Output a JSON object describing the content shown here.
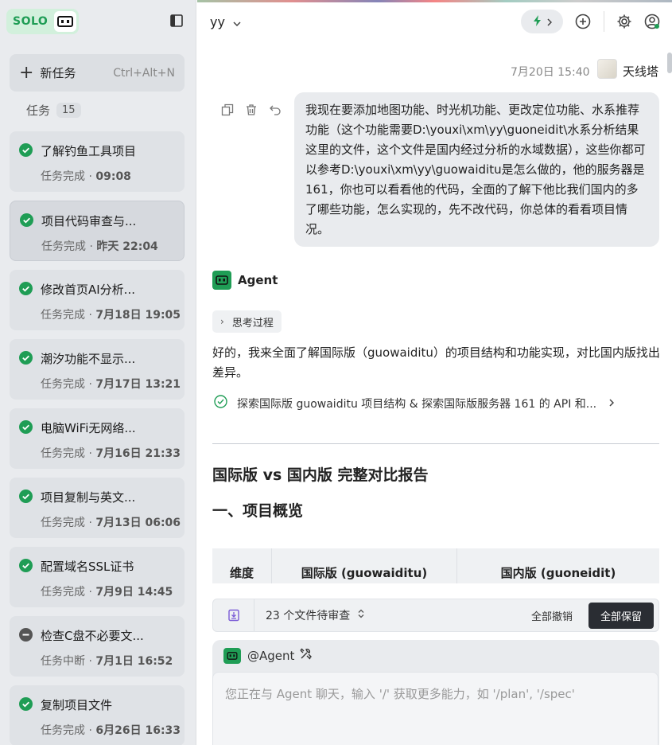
{
  "sidebar": {
    "solo_label": "SOLO",
    "new_task": {
      "label": "新任务",
      "shortcut": "Ctrl+Alt+N"
    },
    "tasks_label": "任务",
    "tasks_count": "15",
    "tasks": [
      {
        "title": "了解钓鱼工具项目",
        "status_text": "任务完成",
        "time": "09:08",
        "state": "done"
      },
      {
        "title": "项目代码审查与...",
        "status_text": "任务完成",
        "time": "昨天 22:04",
        "state": "done"
      },
      {
        "title": "修改首页AI分析...",
        "status_text": "任务完成",
        "time": "7月18日 19:05",
        "state": "done"
      },
      {
        "title": "潮汐功能不显示...",
        "status_text": "任务完成",
        "time": "7月17日 13:21",
        "state": "done"
      },
      {
        "title": "电脑WiFi无网络...",
        "status_text": "任务完成",
        "time": "7月16日 21:33",
        "state": "done"
      },
      {
        "title": "项目复制与英文...",
        "status_text": "任务完成",
        "time": "7月13日 06:06",
        "state": "done"
      },
      {
        "title": "配置域名SSL证书",
        "status_text": "任务完成",
        "time": "7月9日 14:45",
        "state": "done"
      },
      {
        "title": "检查C盘不必要文...",
        "status_text": "任务中断",
        "time": "7月1日 16:52",
        "state": "interrupted"
      },
      {
        "title": "复制项目文件",
        "status_text": "任务完成",
        "time": "6月26日 16:33",
        "state": "done"
      }
    ]
  },
  "header": {
    "project": "yy"
  },
  "chat": {
    "timestamp": "7月20日 15:40",
    "user_name": "天线塔",
    "user_message": "我现在要添加地图功能、时光机功能、更改定位功能、水系推荐功能（这个功能需要D:\\youxi\\xm\\yy\\guoneidit\\水系分析结果这里的文件，这个文件是国内经过分析的水域数据），这些你都可以参考D:\\youxi\\xm\\yy\\guowaiditu是怎么做的，他的服务器是161，你也可以看看他的代码，全面的了解下他比我们国内的多了哪些功能，怎么实现的，先不改代码，你总体的看看项目情况。",
    "agent_name": "Agent",
    "thinking_label": "思考过程",
    "agent_reply": "好的，我来全面了解国际版（guowaiditu）的项目结构和功能实现，对比国内版找出差异。",
    "explore_step": "探索国际版 guowaiditu 项目结构 & 探索国际版服务器 161 的 API 和...",
    "report_title": "国际版 vs 国内版 完整对比报告",
    "section_title": "一、项目概览",
    "table_headers": [
      "维度",
      "国际版 (guowaiditu)",
      "国内版 (guoneidit)"
    ]
  },
  "review_bar": {
    "pending_text": "23 个文件待审查",
    "discard_all": "全部撤销",
    "keep_all": "全部保留"
  },
  "input": {
    "mention": "@Agent",
    "placeholder": "您正在与 Agent 聊天，输入 '/' 获取更多能力，如 '/plan', '/spec'"
  },
  "colors": {
    "accent_green": "#1f9d55",
    "interrupted_gray": "#555555"
  }
}
